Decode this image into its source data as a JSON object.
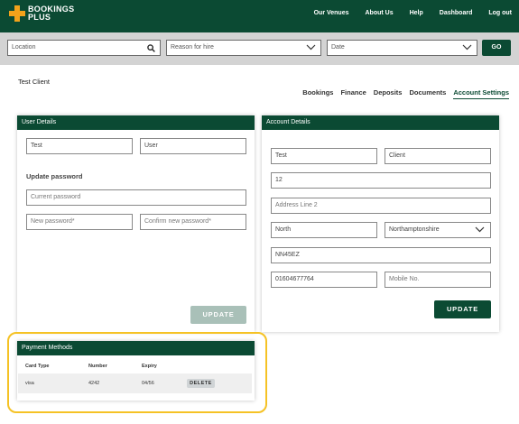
{
  "brand": {
    "line1": "BOOKINGS",
    "line2": "PLUS",
    "primary": "#0b4a33",
    "accent": "#f2a21b",
    "highlight": "#f5c225"
  },
  "nav": {
    "items": [
      "Our Venues",
      "About Us",
      "Help",
      "Dashboard",
      "Log out"
    ]
  },
  "search": {
    "location": "Location",
    "reason": "Reason for hire",
    "date": "Date",
    "go": "GO"
  },
  "client_name": "Test Client",
  "subtabs": {
    "items": [
      "Bookings",
      "Finance",
      "Deposits",
      "Documents",
      "Account Settings"
    ],
    "active": "Account Settings"
  },
  "user_details": {
    "title": "User Details",
    "first_name": "Test",
    "last_name": "User",
    "update_password_label": "Update password",
    "current_password_placeholder": "Current password",
    "new_password_placeholder": "New password*",
    "confirm_password_placeholder": "Confirm new password*",
    "update_label": "UPDATE"
  },
  "account_details": {
    "title": "Account Details",
    "first_name": "Test",
    "last_name": "Client",
    "address_line_1": "12",
    "address_line_2_placeholder": "Address Line 2",
    "town": "North",
    "county": "Northamptonshire",
    "postcode": "NN45EZ",
    "phone": "01604677764",
    "mobile_placeholder": "Mobile No.",
    "update_label": "UPDATE"
  },
  "payment_methods": {
    "title": "Payment Methods",
    "headers": [
      "Card Type",
      "Number",
      "Expiry"
    ],
    "rows": [
      {
        "card_type": "visa",
        "number": "4242",
        "expiry": "04/56",
        "action": "DELETE"
      }
    ]
  }
}
